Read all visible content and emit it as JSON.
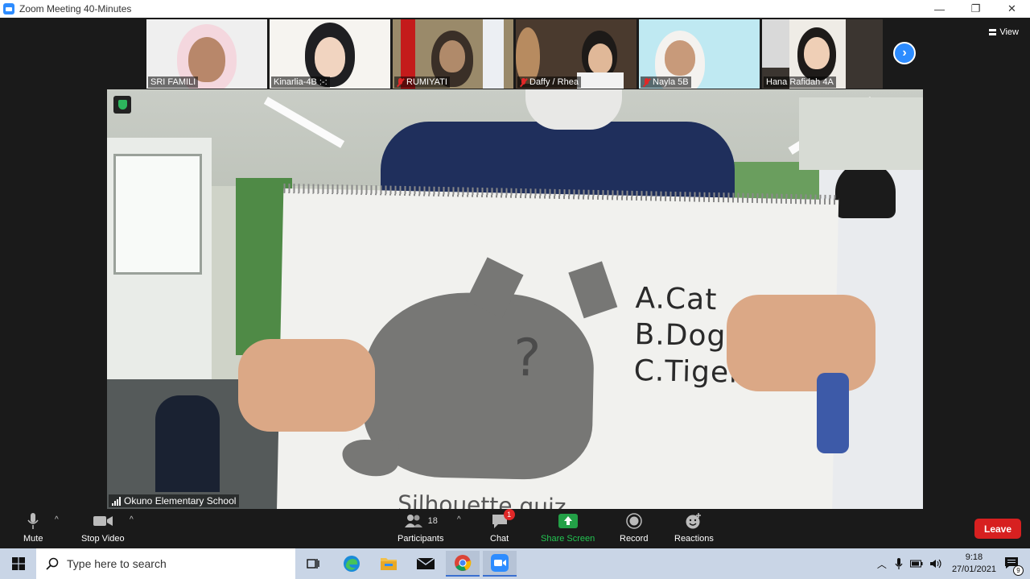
{
  "window": {
    "title": "Zoom Meeting 40-Minutes",
    "controls": [
      "—",
      "❐",
      "✕"
    ]
  },
  "gallery": {
    "participants": [
      {
        "name": "SRI FAMILI",
        "muted": false
      },
      {
        "name": "Kinarlia-4B :-:",
        "muted": false
      },
      {
        "name": "RUMIYATI",
        "muted": true
      },
      {
        "name": "Daffy / Rhea",
        "muted": true
      },
      {
        "name": "Nayla 5B",
        "muted": true
      },
      {
        "name": "Hana Rafidah 4A",
        "muted": false
      }
    ],
    "view_label": "View"
  },
  "main_video": {
    "speaker_name": "Okuno Elementary School",
    "board_lines": [
      "A.Cat",
      "B.Dog",
      "C.Tiger"
    ],
    "board_question_mark": "?",
    "board_bottom": "Silhouette quiz"
  },
  "toolbar": {
    "mute": "Mute",
    "stop_video": "Stop Video",
    "participants": "Participants",
    "participants_count": "18",
    "chat": "Chat",
    "chat_badge": "1",
    "share_screen": "Share Screen",
    "record": "Record",
    "reactions": "Reactions",
    "leave": "Leave",
    "caret": "^"
  },
  "taskbar": {
    "search_placeholder": "Type here to search",
    "time": "9:18",
    "date": "27/01/2021",
    "notification_count": "9"
  },
  "colors": {
    "zoom_blue": "#2d8cff",
    "leave_red": "#d72020",
    "share_green": "#23a047",
    "taskbar": "#c9d5e6"
  }
}
